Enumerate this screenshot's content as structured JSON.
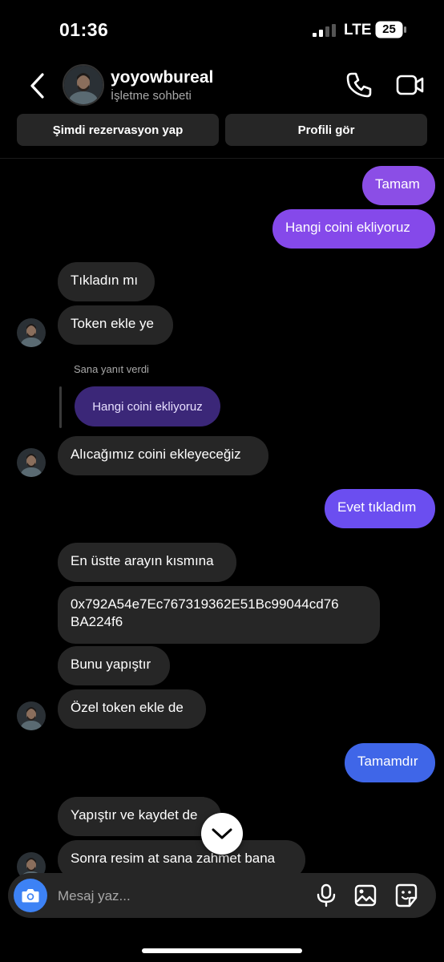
{
  "status_bar": {
    "time": "01:36",
    "network": "LTE",
    "battery": "25"
  },
  "header": {
    "username": "yoyowbureal",
    "subtitle": "İşletme sohbeti",
    "icons": [
      "back-arrow-icon",
      "phone-icon",
      "video-camera-icon"
    ]
  },
  "actions": {
    "book": "Şimdi rezervasyon yap",
    "profile": "Profili gör"
  },
  "messages": {
    "m1": "Tamam",
    "m2": "Hangi coini ekliyoruz",
    "m3": "Tıkladın mı",
    "m4": "Token ekle ye",
    "reply_label": "Sana yanıt verdi",
    "reply_quote": "Hangi coini ekliyoruz",
    "m5": "Alıcağımız coini ekleyeceğiz",
    "m6": "Evet tıkladım",
    "m7": "En üstte arayın kısmına",
    "m8_line1": "0x792A54e7Ec767319362E51Bc99044cd76",
    "m8_line2": "BA224f6",
    "m9": "Bunu yapıştır",
    "m10": "Özel token ekle de",
    "m11": "Tamamdır",
    "m12": "Yapıştır ve kaydet de",
    "m13": "Sonra resim at sana zahmet bana"
  },
  "composer": {
    "placeholder": "Mesaj yaz..."
  },
  "colors": {
    "bubble_out_top": "#8b4ee6",
    "bubble_out_mid": "#6b4ef0",
    "bubble_out_bottom": "#3f66e8",
    "bubble_in": "#262626",
    "camera_button": "#3d82f5"
  }
}
